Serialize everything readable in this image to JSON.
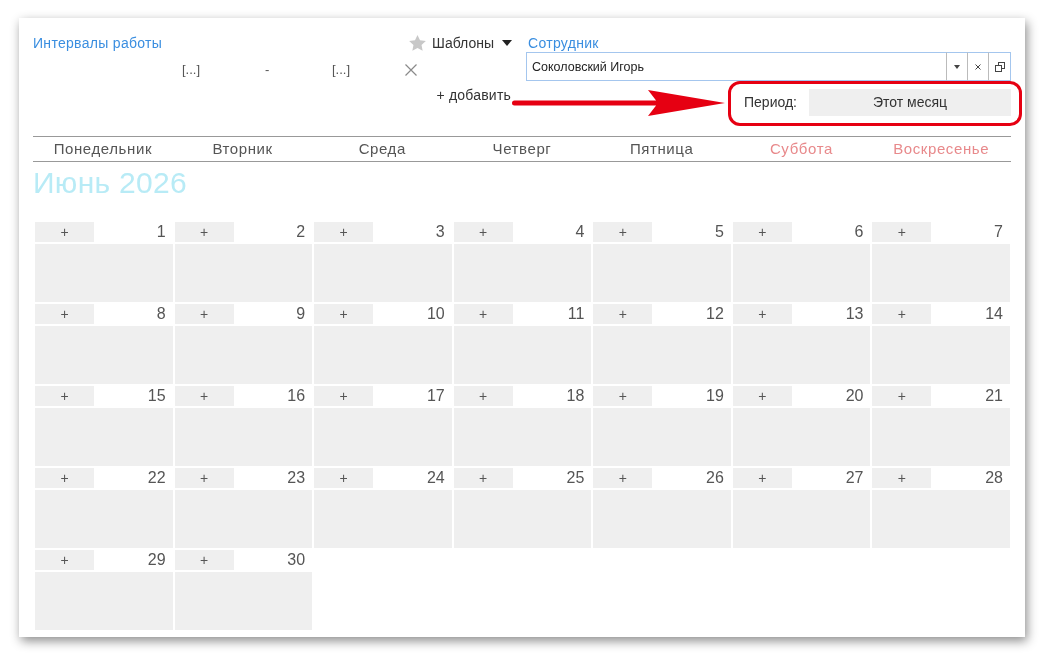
{
  "intervals": {
    "title": "Интервалы работы",
    "rows": [
      {
        "start": "[...]",
        "separator": "-",
        "end": "[...]"
      }
    ],
    "add": "+ добавить"
  },
  "templates": {
    "label": "Шаблоны"
  },
  "employee": {
    "label": "Сотрудник",
    "value": "Соколовский Игорь"
  },
  "period": {
    "label": "Период:",
    "value": "Этот месяц"
  },
  "weekdays": [
    {
      "label": "Понедельник",
      "weekend": false
    },
    {
      "label": "Вторник",
      "weekend": false
    },
    {
      "label": "Среда",
      "weekend": false
    },
    {
      "label": "Четверг",
      "weekend": false
    },
    {
      "label": "Пятница",
      "weekend": false
    },
    {
      "label": "Суббота",
      "weekend": true
    },
    {
      "label": "Воскресенье",
      "weekend": true
    }
  ],
  "calendar": {
    "title": "Июнь 2026",
    "weeks": [
      [
        {
          "add": "+",
          "day": "1"
        },
        {
          "add": "+",
          "day": "2"
        },
        {
          "add": "+",
          "day": "3"
        },
        {
          "add": "+",
          "day": "4"
        },
        {
          "add": "+",
          "day": "5"
        },
        {
          "add": "+",
          "day": "6"
        },
        {
          "add": "+",
          "day": "7"
        }
      ],
      [
        {
          "add": "+",
          "day": "8"
        },
        {
          "add": "+",
          "day": "9"
        },
        {
          "add": "+",
          "day": "10"
        },
        {
          "add": "+",
          "day": "11"
        },
        {
          "add": "+",
          "day": "12"
        },
        {
          "add": "+",
          "day": "13"
        },
        {
          "add": "+",
          "day": "14"
        }
      ],
      [
        {
          "add": "+",
          "day": "15"
        },
        {
          "add": "+",
          "day": "16"
        },
        {
          "add": "+",
          "day": "17"
        },
        {
          "add": "+",
          "day": "18"
        },
        {
          "add": "+",
          "day": "19"
        },
        {
          "add": "+",
          "day": "20"
        },
        {
          "add": "+",
          "day": "21"
        }
      ],
      [
        {
          "add": "+",
          "day": "22"
        },
        {
          "add": "+",
          "day": "23"
        },
        {
          "add": "+",
          "day": "24"
        },
        {
          "add": "+",
          "day": "25"
        },
        {
          "add": "+",
          "day": "26"
        },
        {
          "add": "+",
          "day": "27"
        },
        {
          "add": "+",
          "day": "28"
        }
      ],
      [
        {
          "add": "+",
          "day": "29"
        },
        {
          "add": "+",
          "day": "30"
        }
      ]
    ]
  }
}
